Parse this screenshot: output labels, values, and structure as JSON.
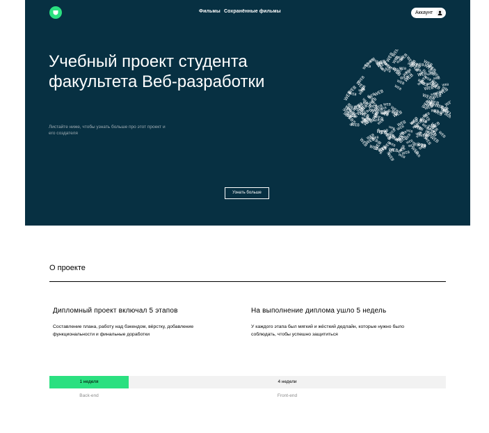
{
  "colors": {
    "hero_bg": "#073042",
    "accent": "#2be080",
    "track": "#f2f2f2"
  },
  "header": {
    "logo_icon": "smile-logo-icon",
    "nav": [
      "Фильмы",
      "Сохранённые фильмы"
    ],
    "account_label": "Аккаунт",
    "account_icon": "user-icon"
  },
  "hero": {
    "title": "Учебный проект студента факультета Веб-разработки",
    "subtitle": "Листайте ниже, чтобы узнать больше про этот проект и его создателя",
    "button_label": "Узнать больше",
    "globe_word": "WEB"
  },
  "about": {
    "title": "О проекте",
    "columns": [
      {
        "heading": "Дипломный проект включал 5 этапов",
        "text": "Составление плана, работу над бэкендом, вёрстку, добавление функциональности и финальные доработки"
      },
      {
        "heading": "На выполнение диплома ушло 5 недель",
        "text": "У каждого этапа был мягкий и жёсткий дедлайн, которые нужно было соблюдать, чтобы успешно защититься"
      }
    ],
    "timeline": [
      {
        "duration": "1 неделя",
        "label": "Back-end"
      },
      {
        "duration": "4 недели",
        "label": "Front-end"
      }
    ]
  }
}
